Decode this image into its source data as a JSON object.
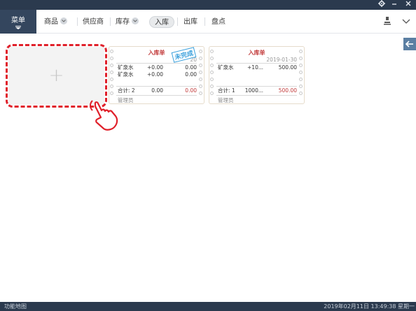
{
  "window": {
    "settings_icon": "gear-icon",
    "minimize_icon": "minus-icon",
    "close_icon": "close-icon"
  },
  "nav": {
    "menu_label": "菜单",
    "items": [
      {
        "label": "商品",
        "has_dropdown": true
      },
      {
        "label": "供应商",
        "has_dropdown": false
      },
      {
        "label": "库存",
        "has_dropdown": true
      },
      {
        "label": "入库",
        "has_dropdown": false,
        "active": true
      },
      {
        "label": "出库",
        "has_dropdown": false
      },
      {
        "label": "盘点",
        "has_dropdown": false
      }
    ],
    "right_icons": [
      "user-icon",
      "chevron-down-icon"
    ]
  },
  "add_card": {
    "plus": "+"
  },
  "cards": [
    {
      "title": "入库单",
      "date": "20",
      "stamp": "未完成",
      "rows": [
        {
          "name": "矿泉水",
          "qty": "+0.00",
          "amount": "0.00"
        },
        {
          "name": "矿泉水",
          "qty": "+0.00",
          "amount": "0.00"
        }
      ],
      "total": {
        "label": "合计:",
        "count": "2",
        "qty": "0.00",
        "amount": "0.00"
      },
      "operator": "管理员"
    },
    {
      "title": "入库单",
      "date": "2019-01-30",
      "rows": [
        {
          "name": "矿泉水",
          "qty": "+10...",
          "amount": "500.00"
        }
      ],
      "total": {
        "label": "合计:",
        "count": "1",
        "qty": "1000...",
        "amount": "500.00"
      },
      "operator": "管理员"
    }
  ],
  "status": {
    "left": "功能地图",
    "right": "2019年02月11日 13:49:38 星期一"
  },
  "colors": {
    "titlebar": "#2b3a4e",
    "menu_bg": "#34465e",
    "accent_red": "#e0202a",
    "stamp_blue": "#3aa0dc"
  }
}
